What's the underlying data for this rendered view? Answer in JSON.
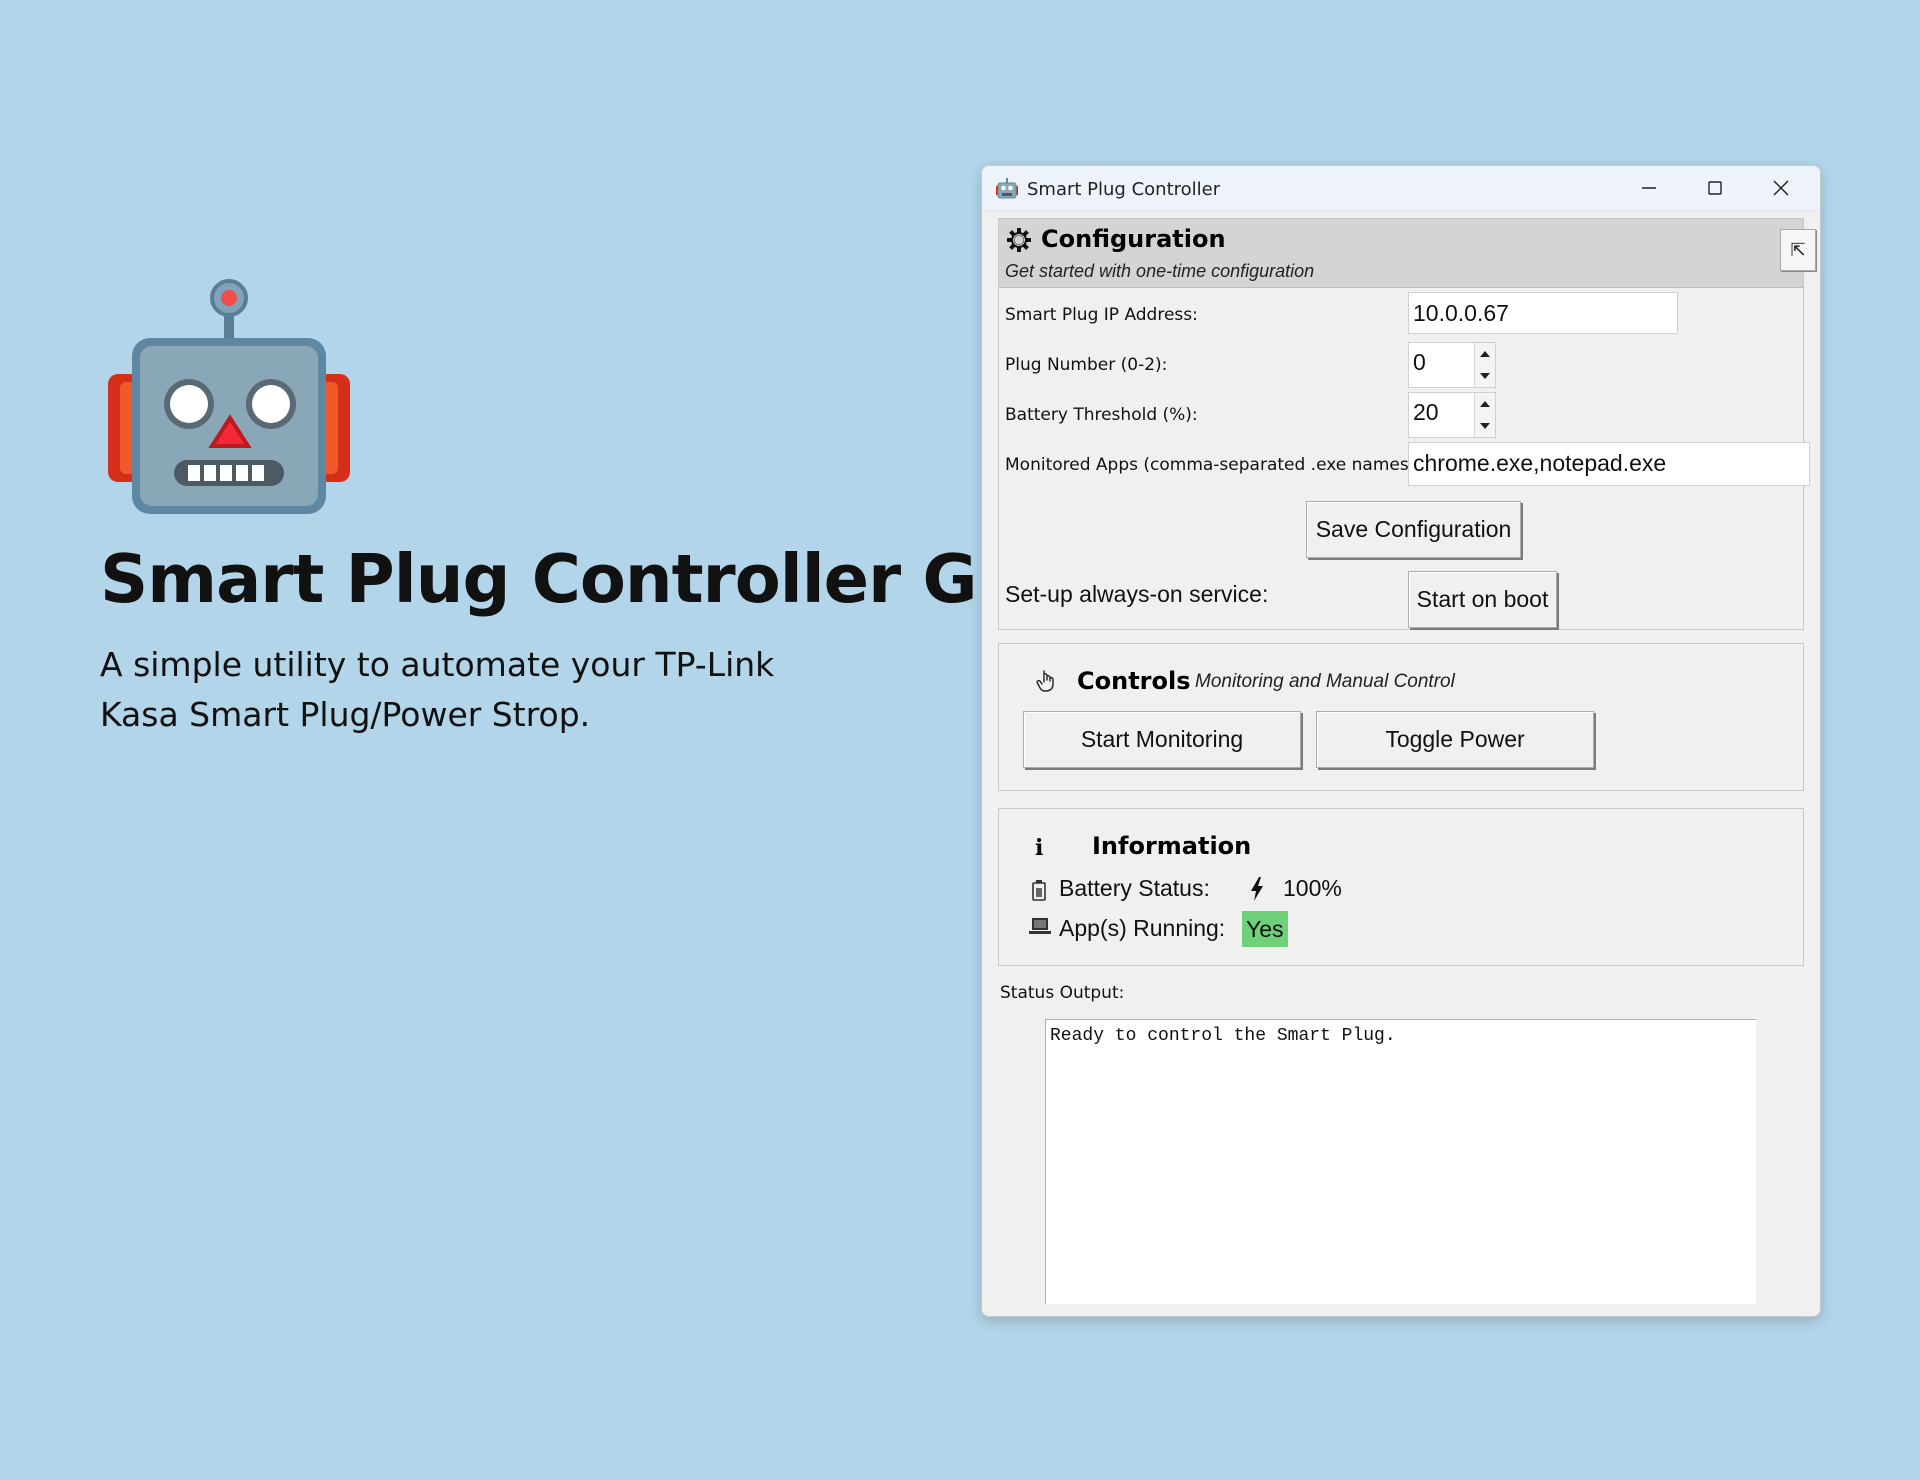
{
  "hero": {
    "title": "Smart Plug Controller GUI",
    "subtitle": "A simple utility to automate your TP-Link Kasa Smart Plug/Power Strop.",
    "logo_icon": "robot-icon"
  },
  "window": {
    "title": "Smart Plug Controller",
    "app_icon": "robot-icon",
    "controls": [
      "minimize-icon",
      "maximize-icon",
      "close-icon"
    ]
  },
  "configuration": {
    "title": "Configuration",
    "subtitle": "Get started with one-time configuration",
    "collapse_icon": "⇱",
    "fields": {
      "ip_label": "Smart Plug IP Address:",
      "ip_value": "10.0.0.67",
      "plug_label": "Plug Number (0-2):",
      "plug_value": "0",
      "threshold_label": "Battery Threshold (%):",
      "threshold_value": "20",
      "apps_label": "Monitored Apps (comma-separated .exe names):",
      "apps_value": "chrome.exe,notepad.exe"
    },
    "save_label": "Save Configuration",
    "service_label": "Set-up always-on service:",
    "boot_label": "Start on boot"
  },
  "controls": {
    "title": "Controls",
    "subtitle": "Monitoring and Manual Control",
    "start_label": "Start Monitoring",
    "toggle_label": "Toggle Power"
  },
  "information": {
    "icon": "i",
    "title": "Information",
    "battery_label": "Battery Status:",
    "battery_value": "100%",
    "apps_label": "App(s) Running:",
    "apps_value": "Yes",
    "apps_value_color": "#6fd07a"
  },
  "status": {
    "label": "Status Output:",
    "text": "Ready to control the Smart Plug."
  },
  "colors": {
    "background": "#b3d5e9",
    "window_bg": "#f0f0f0",
    "header_bg": "#d4d4d4"
  }
}
